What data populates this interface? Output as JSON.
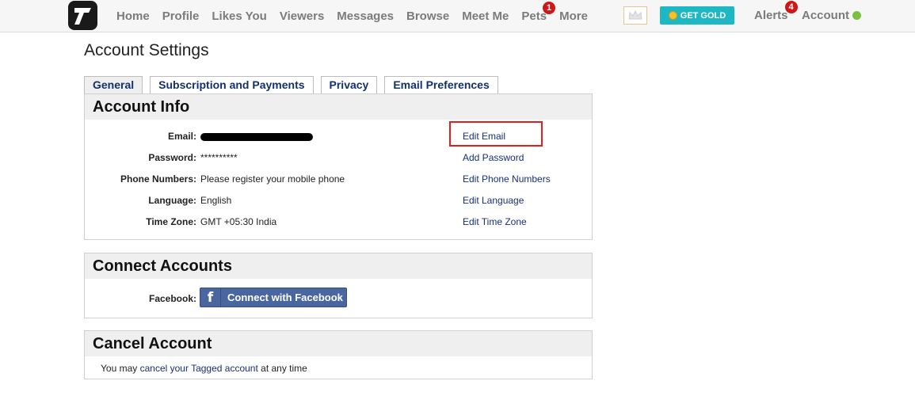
{
  "nav": {
    "items": [
      {
        "label": "Home"
      },
      {
        "label": "Profile"
      },
      {
        "label": "Likes You"
      },
      {
        "label": "Viewers"
      },
      {
        "label": "Messages"
      },
      {
        "label": "Browse"
      },
      {
        "label": "Meet Me"
      },
      {
        "label": "Pets",
        "badge": "1"
      },
      {
        "label": "More"
      }
    ],
    "gold_label": "GET GOLD",
    "alerts_label": "Alerts",
    "alerts_badge": "4",
    "account_label": "Account"
  },
  "page": {
    "title": "Account Settings"
  },
  "tabs": [
    {
      "label": "General"
    },
    {
      "label": "Subscription and Payments"
    },
    {
      "label": "Privacy"
    },
    {
      "label": "Email Preferences"
    }
  ],
  "account_info": {
    "header": "Account Info",
    "email_label": "Email:",
    "password_label": "Password:",
    "password_value": "**********",
    "phone_label": "Phone Numbers:",
    "phone_value": "Please register your mobile phone",
    "language_label": "Language:",
    "language_value": "English",
    "timezone_label": "Time Zone:",
    "timezone_value": "GMT +05:30 India",
    "edit_email": "Edit Email",
    "add_password": "Add Password",
    "edit_phone": "Edit Phone Numbers",
    "edit_language": "Edit Language",
    "edit_timezone": "Edit Time Zone"
  },
  "connect_accounts": {
    "header": "Connect Accounts",
    "facebook_label": "Facebook:",
    "facebook_button": "Connect with Facebook"
  },
  "cancel_account": {
    "header": "Cancel Account",
    "text_before": "You may ",
    "link": "cancel your Tagged account",
    "text_after": " at any time"
  },
  "colors": {
    "link": "#15307a",
    "gold_button": "#1eb8c4",
    "badge": "#cc1818",
    "highlight": "#e02020",
    "facebook": "#4a66a0"
  }
}
